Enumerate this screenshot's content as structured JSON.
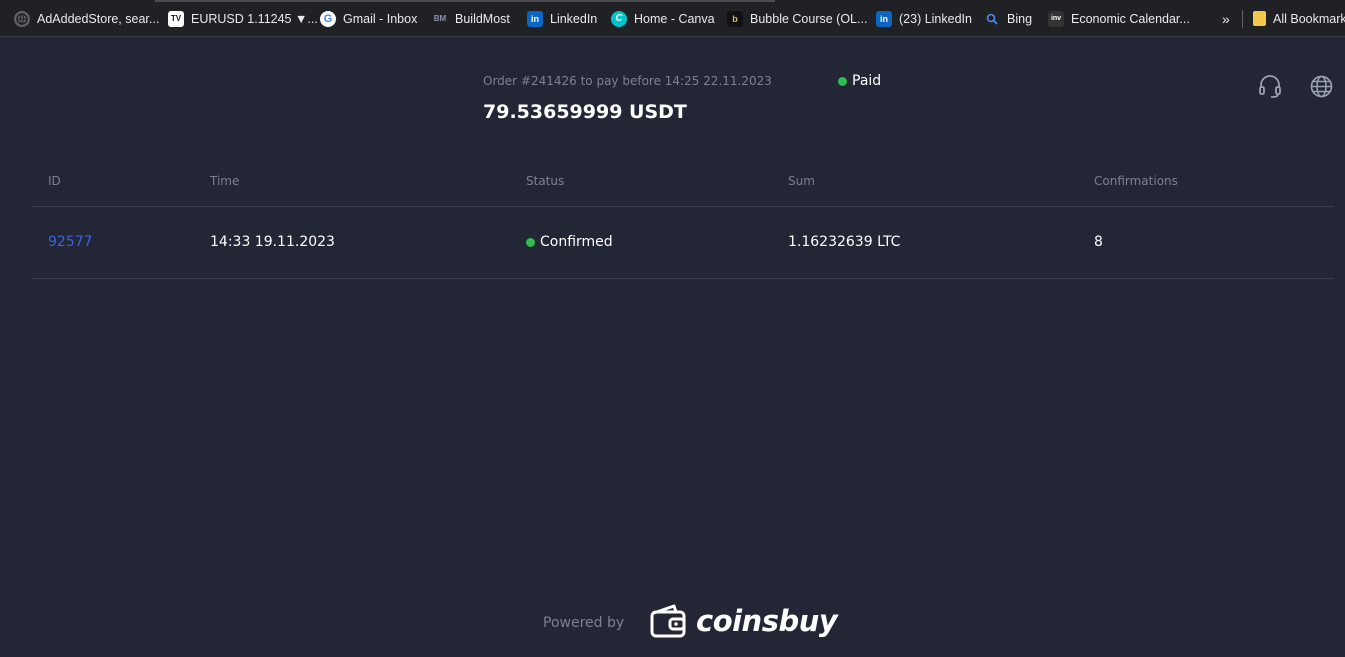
{
  "bookmarks": {
    "items": [
      {
        "label": "AdAddedStore, sear...",
        "icon": "globe-icon",
        "icon_color": "#9aa0a6"
      },
      {
        "label": "EURUSD 1.11245 ▼...",
        "icon": "tradingview-icon",
        "icon_color": "#131722"
      },
      {
        "label": "Gmail - Inbox",
        "icon": "google-icon",
        "icon_color": "#ffffff"
      },
      {
        "label": "BuildMost",
        "icon": "buildmost-icon",
        "icon_color": "#4a4f66"
      },
      {
        "label": "LinkedIn",
        "icon": "linkedin-icon",
        "icon_color": "#0a66c2"
      },
      {
        "label": "Home - Canva",
        "icon": "canva-icon",
        "icon_color": "#00c4cc"
      },
      {
        "label": "Bubble Course (OL...",
        "icon": "bubble-icon",
        "icon_color": "#222222"
      },
      {
        "label": "(23) LinkedIn",
        "icon": "linkedin-icon",
        "icon_color": "#0a66c2"
      },
      {
        "label": "Bing",
        "icon": "search-icon",
        "icon_color": "#1a73e8"
      },
      {
        "label": "Economic Calendar...",
        "icon": "investing-icon",
        "icon_color": "#333333"
      }
    ],
    "more_label": "»",
    "all_bookmarks_label": "All Bookmark"
  },
  "header": {
    "order_text": "Order #241426 to pay before 14:25 22.11.2023",
    "amount": "79.53659999 USDT",
    "status": "Paid",
    "status_color": "#2ebd4f",
    "support_icon": "headset-icon",
    "language_icon": "globe-icon"
  },
  "table": {
    "columns": [
      "ID",
      "Time",
      "Status",
      "Sum",
      "Confirmations"
    ],
    "rows": [
      {
        "id": "92577",
        "time": "14:33 19.11.2023",
        "status": "Confirmed",
        "sum": "1.16232639 LTC",
        "confirmations": "8"
      }
    ]
  },
  "footer": {
    "powered_by": "Powered by",
    "brand": "coinsbuy",
    "brand_icon": "wallet-icon"
  },
  "colors": {
    "background": "#232635",
    "link": "#3b62e0",
    "muted": "#7c8192",
    "success": "#2ebd4f"
  }
}
